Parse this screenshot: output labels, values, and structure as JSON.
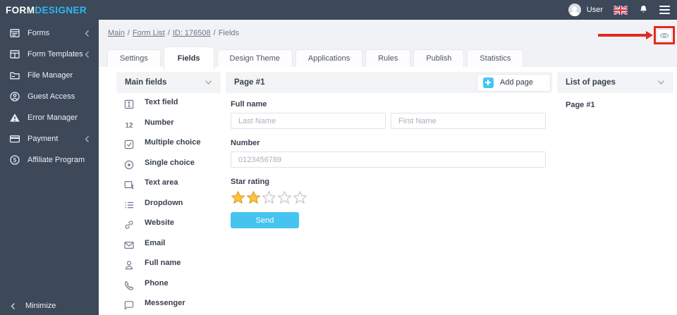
{
  "header": {
    "logo_part1": "FORM",
    "logo_part2": "DESIGNER",
    "user_label": "User",
    "icons": {
      "avatar": "avatar",
      "language_flag": "uk-flag-icon",
      "notifications": "bell-icon",
      "menu": "hamburger-icon"
    }
  },
  "sidebar": {
    "items": [
      {
        "label": "Forms",
        "icon": "forms-icon",
        "expandable": true
      },
      {
        "label": "Form Templates",
        "icon": "form-templates-icon",
        "expandable": true
      },
      {
        "label": "File Manager",
        "icon": "file-manager-icon",
        "expandable": false
      },
      {
        "label": "Guest Access",
        "icon": "guest-access-icon",
        "expandable": false
      },
      {
        "label": "Error Manager",
        "icon": "error-manager-icon",
        "expandable": false
      },
      {
        "label": "Payment",
        "icon": "payment-icon",
        "expandable": true
      },
      {
        "label": "Affiliate Program",
        "icon": "affiliate-program-icon",
        "expandable": false
      }
    ],
    "minimize_label": "Minimize"
  },
  "breadcrumb": {
    "separator": "/",
    "items": [
      {
        "label": "Main",
        "link": true
      },
      {
        "label": "Form List",
        "link": true
      },
      {
        "label": "ID: 176508",
        "link": true
      },
      {
        "label": "Fields",
        "link": false
      }
    ]
  },
  "tabs": [
    {
      "label": "Settings",
      "active": false
    },
    {
      "label": "Fields",
      "active": true
    },
    {
      "label": "Design Theme",
      "active": false
    },
    {
      "label": "Applications",
      "active": false
    },
    {
      "label": "Rules",
      "active": false
    },
    {
      "label": "Publish",
      "active": false
    },
    {
      "label": "Statistics",
      "active": false
    }
  ],
  "fields_panel": {
    "title": "Main fields",
    "items": [
      {
        "label": "Text field",
        "icon": "text-field-icon"
      },
      {
        "label": "Number",
        "icon": "number-icon"
      },
      {
        "label": "Multiple choice",
        "icon": "multiple-choice-icon"
      },
      {
        "label": "Single choice",
        "icon": "single-choice-icon"
      },
      {
        "label": "Text area",
        "icon": "text-area-icon"
      },
      {
        "label": "Dropdown",
        "icon": "dropdown-icon"
      },
      {
        "label": "Website",
        "icon": "website-icon"
      },
      {
        "label": "Email",
        "icon": "email-icon"
      },
      {
        "label": "Full name",
        "icon": "full-name-icon"
      },
      {
        "label": "Phone",
        "icon": "phone-icon"
      },
      {
        "label": "Messenger",
        "icon": "messenger-icon"
      }
    ]
  },
  "page_panel": {
    "title": "Page #1",
    "add_page_label": "Add page",
    "form": {
      "full_name": {
        "label": "Full name",
        "last_name_placeholder": "Last Name",
        "first_name_placeholder": "First Name"
      },
      "number": {
        "label": "Number",
        "placeholder": "0123456789"
      },
      "star_rating": {
        "label": "Star rating",
        "total": 5,
        "filled": 2
      },
      "send_label": "Send"
    }
  },
  "pages_panel": {
    "title": "List of pages",
    "pages": [
      "Page #1"
    ]
  },
  "annotation": {
    "target": "preview-eye-button"
  },
  "colors": {
    "topbar_bg": "#3d4859",
    "accent_blue": "#2eb6f3",
    "send_button_blue": "#45c4f0",
    "annotation_red": "#e02b20",
    "star_filled": "#fdc538"
  }
}
